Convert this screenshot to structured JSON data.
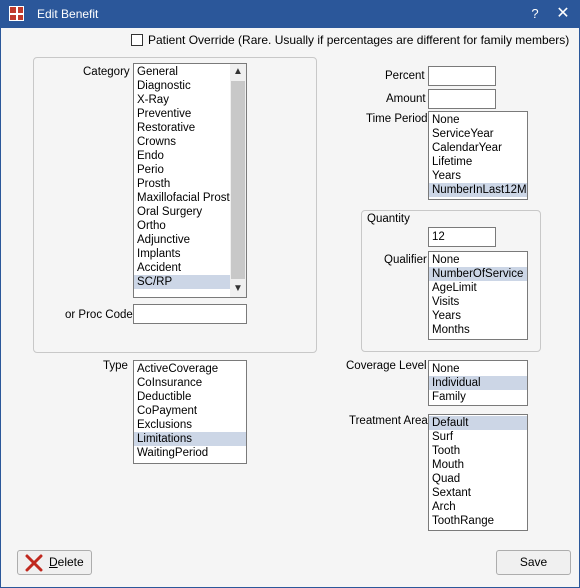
{
  "window": {
    "title": "Edit Benefit",
    "help": "?",
    "close": "✕"
  },
  "patient_override": {
    "label": "Patient Override (Rare. Usually if percentages are different for family members)",
    "checked": false
  },
  "category": {
    "label": "Category",
    "items": [
      "General",
      "Diagnostic",
      "X-Ray",
      "Preventive",
      "Restorative",
      "Crowns",
      "Endo",
      "Perio",
      "Prosth",
      "Maxillofacial Prost",
      "Oral Surgery",
      "Ortho",
      "Adjunctive",
      "Implants",
      "Accident",
      "SC/RP"
    ],
    "selected": "SC/RP"
  },
  "proc_code": {
    "label": "or Proc Code",
    "value": ""
  },
  "type": {
    "label": "Type",
    "items": [
      "ActiveCoverage",
      "CoInsurance",
      "Deductible",
      "CoPayment",
      "Exclusions",
      "Limitations",
      "WaitingPeriod"
    ],
    "selected": "Limitations"
  },
  "percent": {
    "label": "Percent",
    "value": ""
  },
  "amount": {
    "label": "Amount",
    "value": ""
  },
  "time_period": {
    "label": "Time Period",
    "items": [
      "None",
      "ServiceYear",
      "CalendarYear",
      "Lifetime",
      "Years",
      "NumberInLast12M"
    ],
    "selected": "NumberInLast12M"
  },
  "quantity": {
    "group_label": "Quantity",
    "value": "12",
    "qualifier_label": "Qualifier",
    "qualifiers": [
      "None",
      "NumberOfService",
      "AgeLimit",
      "Visits",
      "Years",
      "Months"
    ],
    "selected": "NumberOfService"
  },
  "coverage_level": {
    "label": "Coverage Level",
    "items": [
      "None",
      "Individual",
      "Family"
    ],
    "selected": "Individual"
  },
  "treatment_area": {
    "label": "Treatment Area",
    "items": [
      "Default",
      "Surf",
      "Tooth",
      "Mouth",
      "Quad",
      "Sextant",
      "Arch",
      "ToothRange"
    ],
    "selected": "Default"
  },
  "buttons": {
    "delete": "Delete",
    "save": "Save"
  }
}
